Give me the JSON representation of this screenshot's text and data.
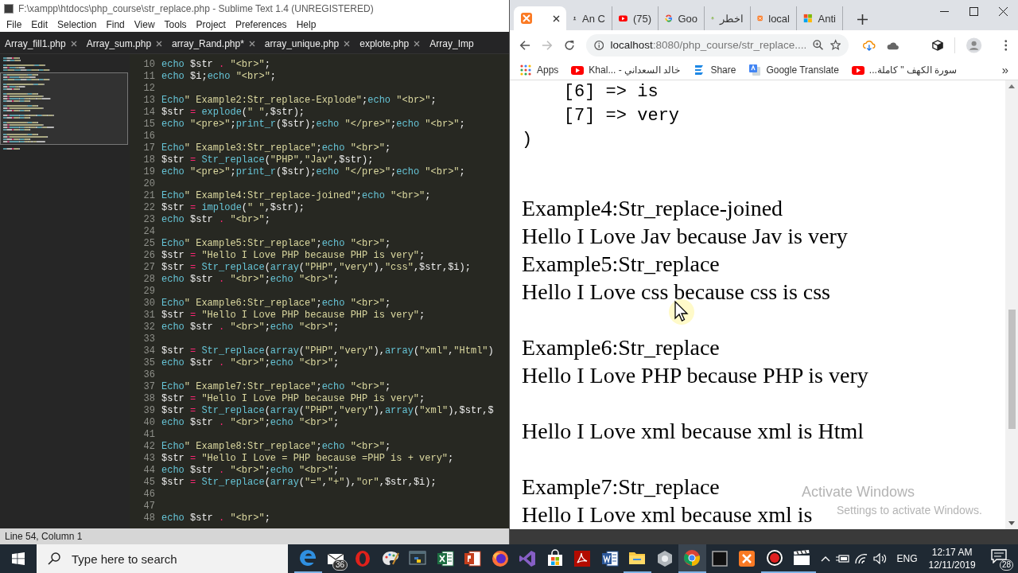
{
  "editor": {
    "title": "F:\\xampp\\htdocs\\php_course\\str_replace.php - Sublime Text 1.4 (UNREGISTERED)",
    "menu": [
      "File",
      "Edit",
      "Selection",
      "Find",
      "View",
      "Tools",
      "Project",
      "Preferences",
      "Help"
    ],
    "tabs": [
      {
        "label": "Array_fill1.php",
        "selected": false,
        "closable": true
      },
      {
        "label": "Array_sum.php",
        "selected": false,
        "closable": true
      },
      {
        "label": "array_Rand.php*",
        "selected": false,
        "closable": true
      },
      {
        "label": "array_unique.php",
        "selected": false,
        "closable": true
      },
      {
        "label": "explote.php",
        "selected": false,
        "closable": true
      },
      {
        "label": "Array_Imp",
        "selected": false,
        "closable": false
      }
    ],
    "lines": [
      {
        "number": "10",
        "tokens": [
          {
            "kind": "keyword",
            "text": "echo"
          },
          {
            "kind": "plain",
            "text": " $str "
          },
          {
            "kind": "operator",
            "text": ". "
          },
          {
            "kind": "string",
            "text": "\"<br>\""
          },
          {
            "kind": "plain",
            "text": ";"
          }
        ]
      },
      {
        "number": "11",
        "tokens": [
          {
            "kind": "keyword",
            "text": "echo"
          },
          {
            "kind": "plain",
            "text": " $i;"
          },
          {
            "kind": "keyword",
            "text": "echo "
          },
          {
            "kind": "string",
            "text": "\"<br>\""
          },
          {
            "kind": "plain",
            "text": ";"
          }
        ]
      },
      {
        "number": "12"
      },
      {
        "number": "13",
        "tokens": [
          {
            "kind": "keyword",
            "text": "Echo"
          },
          {
            "kind": "string",
            "text": "\" Example2:Str_replace-Explode\""
          },
          {
            "kind": "plain",
            "text": ";"
          },
          {
            "kind": "keyword",
            "text": "echo "
          },
          {
            "kind": "string",
            "text": "\"<br>\""
          },
          {
            "kind": "plain",
            "text": ";"
          }
        ]
      },
      {
        "number": "14",
        "tokens": [
          {
            "kind": "plain",
            "text": "$str "
          },
          {
            "kind": "operator",
            "text": "= "
          },
          {
            "kind": "function",
            "text": "explode"
          },
          {
            "kind": "plain",
            "text": "("
          },
          {
            "kind": "string",
            "text": "\" \""
          },
          {
            "kind": "plain",
            "text": ",$str);"
          }
        ]
      },
      {
        "number": "15",
        "tokens": [
          {
            "kind": "keyword",
            "text": "echo "
          },
          {
            "kind": "string",
            "text": "\"<pre>\""
          },
          {
            "kind": "plain",
            "text": ";"
          },
          {
            "kind": "function",
            "text": "print_r"
          },
          {
            "kind": "plain",
            "text": "($str);"
          },
          {
            "kind": "keyword",
            "text": "echo "
          },
          {
            "kind": "string",
            "text": "\"</pre>\""
          },
          {
            "kind": "plain",
            "text": ";"
          },
          {
            "kind": "keyword",
            "text": "echo "
          },
          {
            "kind": "string",
            "text": "\"<br>\""
          },
          {
            "kind": "plain",
            "text": ";"
          }
        ]
      },
      {
        "number": "16"
      },
      {
        "number": "17",
        "tokens": [
          {
            "kind": "keyword",
            "text": "Echo"
          },
          {
            "kind": "string",
            "text": "\" Example3:Str_replace\""
          },
          {
            "kind": "plain",
            "text": ";"
          },
          {
            "kind": "keyword",
            "text": "echo "
          },
          {
            "kind": "string",
            "text": "\"<br>\""
          },
          {
            "kind": "plain",
            "text": ";"
          }
        ]
      },
      {
        "number": "18",
        "tokens": [
          {
            "kind": "plain",
            "text": "$str "
          },
          {
            "kind": "operator",
            "text": "= "
          },
          {
            "kind": "function",
            "text": "Str_replace"
          },
          {
            "kind": "plain",
            "text": "("
          },
          {
            "kind": "string",
            "text": "\"PHP\""
          },
          {
            "kind": "plain",
            "text": ","
          },
          {
            "kind": "string",
            "text": "\"Jav\""
          },
          {
            "kind": "plain",
            "text": ",$str);"
          }
        ]
      },
      {
        "number": "19",
        "tokens": [
          {
            "kind": "keyword",
            "text": "echo "
          },
          {
            "kind": "string",
            "text": "\"<pre>\""
          },
          {
            "kind": "plain",
            "text": ";"
          },
          {
            "kind": "function",
            "text": "print_r"
          },
          {
            "kind": "plain",
            "text": "($str);"
          },
          {
            "kind": "keyword",
            "text": "echo "
          },
          {
            "kind": "string",
            "text": "\"</pre>\""
          },
          {
            "kind": "plain",
            "text": ";"
          },
          {
            "kind": "keyword",
            "text": "echo "
          },
          {
            "kind": "string",
            "text": "\"<br>\""
          },
          {
            "kind": "plain",
            "text": ";"
          }
        ]
      },
      {
        "number": "20"
      },
      {
        "number": "21",
        "tokens": [
          {
            "kind": "keyword",
            "text": "Echo"
          },
          {
            "kind": "string",
            "text": "\" Example4:Str_replace-joined\""
          },
          {
            "kind": "plain",
            "text": ";"
          },
          {
            "kind": "keyword",
            "text": "echo "
          },
          {
            "kind": "string",
            "text": "\"<br>\""
          },
          {
            "kind": "plain",
            "text": ";"
          }
        ]
      },
      {
        "number": "22",
        "tokens": [
          {
            "kind": "plain",
            "text": "$str "
          },
          {
            "kind": "operator",
            "text": "= "
          },
          {
            "kind": "function",
            "text": "implode"
          },
          {
            "kind": "plain",
            "text": "("
          },
          {
            "kind": "string",
            "text": "\" \""
          },
          {
            "kind": "plain",
            "text": ",$str);"
          }
        ]
      },
      {
        "number": "23",
        "tokens": [
          {
            "kind": "keyword",
            "text": "echo"
          },
          {
            "kind": "plain",
            "text": " $str "
          },
          {
            "kind": "operator",
            "text": ". "
          },
          {
            "kind": "string",
            "text": "\"<br>\""
          },
          {
            "kind": "plain",
            "text": ";"
          }
        ]
      },
      {
        "number": "24"
      },
      {
        "number": "25",
        "tokens": [
          {
            "kind": "keyword",
            "text": "Echo"
          },
          {
            "kind": "string",
            "text": "\" Example5:Str_replace\""
          },
          {
            "kind": "plain",
            "text": ";"
          },
          {
            "kind": "keyword",
            "text": "echo "
          },
          {
            "kind": "string",
            "text": "\"<br>\""
          },
          {
            "kind": "plain",
            "text": ";"
          }
        ]
      },
      {
        "number": "26",
        "tokens": [
          {
            "kind": "plain",
            "text": "$str "
          },
          {
            "kind": "operator",
            "text": "= "
          },
          {
            "kind": "string",
            "text": "\"Hello I Love PHP because PHP is very\""
          },
          {
            "kind": "plain",
            "text": ";"
          }
        ]
      },
      {
        "number": "27",
        "tokens": [
          {
            "kind": "plain",
            "text": "$str "
          },
          {
            "kind": "operator",
            "text": "= "
          },
          {
            "kind": "function",
            "text": "Str_replace"
          },
          {
            "kind": "plain",
            "text": "("
          },
          {
            "kind": "function",
            "text": "array"
          },
          {
            "kind": "plain",
            "text": "("
          },
          {
            "kind": "string",
            "text": "\"PHP\""
          },
          {
            "kind": "plain",
            "text": ","
          },
          {
            "kind": "string",
            "text": "\"very\""
          },
          {
            "kind": "plain",
            "text": "),"
          },
          {
            "kind": "string",
            "text": "\"css\""
          },
          {
            "kind": "plain",
            "text": ",$str,$i);"
          }
        ]
      },
      {
        "number": "28",
        "tokens": [
          {
            "kind": "keyword",
            "text": "echo"
          },
          {
            "kind": "plain",
            "text": " $str "
          },
          {
            "kind": "operator",
            "text": ". "
          },
          {
            "kind": "string",
            "text": "\"<br>\""
          },
          {
            "kind": "plain",
            "text": ";"
          },
          {
            "kind": "keyword",
            "text": "echo "
          },
          {
            "kind": "string",
            "text": "\"<br>\""
          },
          {
            "kind": "plain",
            "text": ";"
          }
        ]
      },
      {
        "number": "29"
      },
      {
        "number": "30",
        "tokens": [
          {
            "kind": "keyword",
            "text": "Echo"
          },
          {
            "kind": "string",
            "text": "\" Example6:Str_replace\""
          },
          {
            "kind": "plain",
            "text": ";"
          },
          {
            "kind": "keyword",
            "text": "echo "
          },
          {
            "kind": "string",
            "text": "\"<br>\""
          },
          {
            "kind": "plain",
            "text": ";"
          }
        ]
      },
      {
        "number": "31",
        "tokens": [
          {
            "kind": "plain",
            "text": "$str "
          },
          {
            "kind": "operator",
            "text": "= "
          },
          {
            "kind": "string",
            "text": "\"Hello I Love PHP because PHP is very\""
          },
          {
            "kind": "plain",
            "text": ";"
          }
        ]
      },
      {
        "number": "32",
        "tokens": [
          {
            "kind": "keyword",
            "text": "echo"
          },
          {
            "kind": "plain",
            "text": " $str "
          },
          {
            "kind": "operator",
            "text": ". "
          },
          {
            "kind": "string",
            "text": "\"<br>\""
          },
          {
            "kind": "plain",
            "text": ";"
          },
          {
            "kind": "keyword",
            "text": "echo "
          },
          {
            "kind": "string",
            "text": "\"<br>\""
          },
          {
            "kind": "plain",
            "text": ";"
          }
        ]
      },
      {
        "number": "33"
      },
      {
        "number": "34",
        "tokens": [
          {
            "kind": "plain",
            "text": "$str "
          },
          {
            "kind": "operator",
            "text": "= "
          },
          {
            "kind": "function",
            "text": "Str_replace"
          },
          {
            "kind": "plain",
            "text": "("
          },
          {
            "kind": "function",
            "text": "array"
          },
          {
            "kind": "plain",
            "text": "("
          },
          {
            "kind": "string",
            "text": "\"PHP\""
          },
          {
            "kind": "plain",
            "text": ","
          },
          {
            "kind": "string",
            "text": "\"very\""
          },
          {
            "kind": "plain",
            "text": "),"
          },
          {
            "kind": "function",
            "text": "array"
          },
          {
            "kind": "plain",
            "text": "("
          },
          {
            "kind": "string",
            "text": "\"xml\""
          },
          {
            "kind": "plain",
            "text": ","
          },
          {
            "kind": "string",
            "text": "\"Html\""
          },
          {
            "kind": "plain",
            "text": ")"
          }
        ]
      },
      {
        "number": "35",
        "tokens": [
          {
            "kind": "keyword",
            "text": "echo"
          },
          {
            "kind": "plain",
            "text": " $str "
          },
          {
            "kind": "operator",
            "text": ". "
          },
          {
            "kind": "string",
            "text": "\"<br>\""
          },
          {
            "kind": "plain",
            "text": ";"
          },
          {
            "kind": "keyword",
            "text": "echo "
          },
          {
            "kind": "string",
            "text": "\"<br>\""
          },
          {
            "kind": "plain",
            "text": ";"
          }
        ]
      },
      {
        "number": "36"
      },
      {
        "number": "37",
        "tokens": [
          {
            "kind": "keyword",
            "text": "Echo"
          },
          {
            "kind": "string",
            "text": "\" Example7:Str_replace\""
          },
          {
            "kind": "plain",
            "text": ";"
          },
          {
            "kind": "keyword",
            "text": "echo "
          },
          {
            "kind": "string",
            "text": "\"<br>\""
          },
          {
            "kind": "plain",
            "text": ";"
          }
        ]
      },
      {
        "number": "38",
        "tokens": [
          {
            "kind": "plain",
            "text": "$str "
          },
          {
            "kind": "operator",
            "text": "= "
          },
          {
            "kind": "string",
            "text": "\"Hello I Love PHP because PHP is very\""
          },
          {
            "kind": "plain",
            "text": ";"
          }
        ]
      },
      {
        "number": "39",
        "tokens": [
          {
            "kind": "plain",
            "text": "$str "
          },
          {
            "kind": "operator",
            "text": "= "
          },
          {
            "kind": "function",
            "text": "Str_replace"
          },
          {
            "kind": "plain",
            "text": "("
          },
          {
            "kind": "function",
            "text": "array"
          },
          {
            "kind": "plain",
            "text": "("
          },
          {
            "kind": "string",
            "text": "\"PHP\""
          },
          {
            "kind": "plain",
            "text": ","
          },
          {
            "kind": "string",
            "text": "\"very\""
          },
          {
            "kind": "plain",
            "text": "),"
          },
          {
            "kind": "function",
            "text": "array"
          },
          {
            "kind": "plain",
            "text": "("
          },
          {
            "kind": "string",
            "text": "\"xml\""
          },
          {
            "kind": "plain",
            "text": "),$str,$"
          }
        ]
      },
      {
        "number": "40",
        "tokens": [
          {
            "kind": "keyword",
            "text": "echo"
          },
          {
            "kind": "plain",
            "text": " $str "
          },
          {
            "kind": "operator",
            "text": ". "
          },
          {
            "kind": "string",
            "text": "\"<br>\""
          },
          {
            "kind": "plain",
            "text": ";"
          },
          {
            "kind": "keyword",
            "text": "echo "
          },
          {
            "kind": "string",
            "text": "\"<br>\""
          },
          {
            "kind": "plain",
            "text": ";"
          }
        ]
      },
      {
        "number": "41"
      },
      {
        "number": "42",
        "tokens": [
          {
            "kind": "keyword",
            "text": "Echo"
          },
          {
            "kind": "string",
            "text": "\" Example8:Str_replace\""
          },
          {
            "kind": "plain",
            "text": ";"
          },
          {
            "kind": "keyword",
            "text": "echo "
          },
          {
            "kind": "string",
            "text": "\"<br>\""
          },
          {
            "kind": "plain",
            "text": ";"
          }
        ]
      },
      {
        "number": "43",
        "tokens": [
          {
            "kind": "plain",
            "text": "$str "
          },
          {
            "kind": "operator",
            "text": "= "
          },
          {
            "kind": "string",
            "text": "\"Hello I Love = PHP because =PHP is + very\""
          },
          {
            "kind": "plain",
            "text": ";"
          }
        ]
      },
      {
        "number": "44",
        "tokens": [
          {
            "kind": "keyword",
            "text": "echo"
          },
          {
            "kind": "plain",
            "text": " $str "
          },
          {
            "kind": "operator",
            "text": ". "
          },
          {
            "kind": "string",
            "text": "\"<br>\""
          },
          {
            "kind": "plain",
            "text": ";"
          },
          {
            "kind": "keyword",
            "text": "echo "
          },
          {
            "kind": "string",
            "text": "\"<br>\""
          },
          {
            "kind": "plain",
            "text": ";"
          }
        ]
      },
      {
        "number": "45",
        "tokens": [
          {
            "kind": "plain",
            "text": "$str "
          },
          {
            "kind": "operator",
            "text": "= "
          },
          {
            "kind": "function",
            "text": "Str_replace"
          },
          {
            "kind": "plain",
            "text": "("
          },
          {
            "kind": "function",
            "text": "array"
          },
          {
            "kind": "plain",
            "text": "("
          },
          {
            "kind": "string",
            "text": "\"=\""
          },
          {
            "kind": "plain",
            "text": ","
          },
          {
            "kind": "string",
            "text": "\"+\""
          },
          {
            "kind": "plain",
            "text": "),"
          },
          {
            "kind": "string",
            "text": "\"or\""
          },
          {
            "kind": "plain",
            "text": ",$str,$i);"
          }
        ]
      },
      {
        "number": "46"
      },
      {
        "number": "47"
      },
      {
        "number": "48",
        "tokens": [
          {
            "kind": "keyword",
            "text": "echo"
          },
          {
            "kind": "plain",
            "text": " $str "
          },
          {
            "kind": "operator",
            "text": ". "
          },
          {
            "kind": "string",
            "text": "\"<br>\""
          },
          {
            "kind": "plain",
            "text": ";"
          }
        ]
      }
    ],
    "status": "Line 54, Column 1"
  },
  "browser": {
    "tabs": [
      {
        "kind": "xampp",
        "selected": true
      },
      {
        "kind": "figure",
        "title": "An C",
        "selected": false
      },
      {
        "kind": "youtube",
        "title": "(75)",
        "selected": false
      },
      {
        "kind": "google",
        "title": "Goo",
        "selected": false
      },
      {
        "kind": "tree",
        "title": "اخطر",
        "selected": false
      },
      {
        "kind": "xampp",
        "title": "local",
        "selected": false
      },
      {
        "kind": "windows",
        "title": "Anti",
        "selected": false
      }
    ],
    "url": {
      "host": "localhost",
      "path": ":8080/php_course/str_replace...."
    },
    "bookmarks": [
      {
        "kind": "apps",
        "label": "Apps"
      },
      {
        "kind": "youtube",
        "label": "Khal... - خالد السعداني"
      },
      {
        "kind": "share",
        "label": "Share"
      },
      {
        "kind": "translate",
        "label": "Google Translate"
      },
      {
        "kind": "youtube",
        "label": "سورة الكهف \" كاملة..."
      }
    ],
    "more_bookmarks": "»",
    "output": [
      {
        "kind": "pre",
        "text": "    [6] => is"
      },
      {
        "kind": "pre",
        "text": "    [7] => very"
      },
      {
        "kind": "pre",
        "text": ")"
      },
      {
        "kind": "break"
      },
      {
        "kind": "line",
        "text": "Example4:Str_replace-joined"
      },
      {
        "kind": "line",
        "text": "Hello I Love Jav because Jav is very"
      },
      {
        "kind": "line",
        "text": "Example5:Str_replace"
      },
      {
        "kind": "line",
        "text": "Hello I Love css because css is css"
      },
      {
        "kind": "break"
      },
      {
        "kind": "line",
        "text": "Example6:Str_replace"
      },
      {
        "kind": "line",
        "text": "Hello I Love PHP because PHP is very"
      },
      {
        "kind": "break"
      },
      {
        "kind": "line",
        "text": "Hello I Love xml because xml is Html"
      },
      {
        "kind": "break"
      },
      {
        "kind": "line",
        "text": "Example7:Str_replace"
      },
      {
        "kind": "line",
        "text": "Hello I Love xml because xml is"
      }
    ]
  },
  "activation": {
    "title": "Activate Windows",
    "subtitle": "Settings to activate Windows."
  },
  "taskbar": {
    "search_placeholder": "Type here to search",
    "apps": [
      {
        "kind": "edge",
        "running": true,
        "selected": false
      },
      {
        "kind": "mail",
        "running": false,
        "selected": false,
        "badge": "36"
      },
      {
        "kind": "opera",
        "running": false,
        "selected": false
      },
      {
        "kind": "paint",
        "running": false,
        "selected": false
      },
      {
        "kind": "python",
        "running": false,
        "selected": false
      },
      {
        "kind": "excel",
        "running": false,
        "selected": false
      },
      {
        "kind": "powerpoint",
        "running": false,
        "selected": false
      },
      {
        "kind": "firefox",
        "running": false,
        "selected": false
      },
      {
        "kind": "studio",
        "running": false,
        "selected": false
      },
      {
        "kind": "store",
        "running": false,
        "selected": false
      },
      {
        "kind": "pdf",
        "running": false,
        "selected": false
      },
      {
        "kind": "word",
        "running": false,
        "selected": false
      },
      {
        "kind": "folder",
        "running": true,
        "selected": false
      },
      {
        "kind": "gear",
        "running": false,
        "selected": false
      },
      {
        "kind": "chrome",
        "running": true,
        "selected": true
      },
      {
        "kind": "terminal",
        "running": false,
        "selected": false
      },
      {
        "kind": "xampp",
        "running": false,
        "selected": false
      },
      {
        "kind": "recorder",
        "running": true,
        "selected": false
      },
      {
        "kind": "video",
        "running": true,
        "selected": false
      }
    ],
    "language": "ENG",
    "time": "12:17 AM",
    "date": "12/11/2019",
    "notifications": "28"
  }
}
